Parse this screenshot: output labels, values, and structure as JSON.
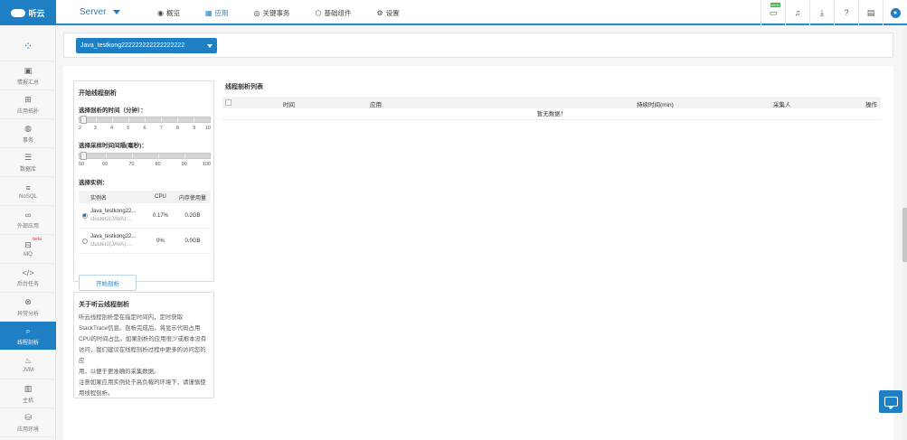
{
  "brand": {
    "logo_text": "听云",
    "accent": "#1f7fc4"
  },
  "server_selector": {
    "label": "Server"
  },
  "nav": [
    {
      "label": "概览",
      "icon": "eye-icon"
    },
    {
      "label": "应用",
      "icon": "grid-icon"
    },
    {
      "label": "关键事务",
      "icon": "target-icon"
    },
    {
      "label": "基础组件",
      "icon": "cube-icon"
    },
    {
      "label": "设置",
      "icon": "gear-icon"
    }
  ],
  "topicons": {
    "new_badge": "NEW"
  },
  "sidebar": [
    {
      "label": "情报汇总"
    },
    {
      "label": "应用拓扑"
    },
    {
      "label": "事务"
    },
    {
      "label": "数据库"
    },
    {
      "label": "NoSQL"
    },
    {
      "label": "外部应用"
    },
    {
      "label": "MQ",
      "badge": "beta"
    },
    {
      "label": "后台任务"
    },
    {
      "label": "异常分析"
    },
    {
      "label": "线程剖析"
    },
    {
      "label": "JVM"
    },
    {
      "label": "主机"
    },
    {
      "label": "应用环境"
    }
  ],
  "app_select": {
    "value": "Java_testkong222222222222222222"
  },
  "start_panel": {
    "title": "开始线程剖析",
    "duration_label": "选择剖析的时间（分钟）：",
    "duration_ticks": [
      "2",
      "3",
      "4",
      "5",
      "6",
      "7",
      "8",
      "9",
      "10"
    ],
    "duration_value": 2,
    "interval_label": "选择采样时间间隔(毫秒)：",
    "interval_ticks": [
      "50",
      "60",
      "70",
      "80",
      "90",
      "100"
    ],
    "interval_value": 50,
    "instance_label": "选择实例：",
    "columns": [
      "实例名",
      "CPU",
      "内存使用量"
    ],
    "instances": [
      {
        "name": "Java_testkong22...",
        "cluster": "cluster2(JAVA):...",
        "cpu": "0.17%",
        "mem": "0.2GB",
        "selected": true
      },
      {
        "name": "Java_testkong22...",
        "cluster": "cluster2(JAVA):...",
        "cpu": "0%",
        "mem": "0.0GB",
        "selected": false
      }
    ],
    "start_button": "开始剖析"
  },
  "about_panel": {
    "title": "关于听云线程剖析",
    "lines": [
      "听云线程剖析是在指定时间内，定时获取",
      "StackTrace信息。剖析完成后，将显示代码占用",
      "CPU的时间占比。如果剖析的应用很少或根本没有",
      "访问，我们建议在线程剖析过程中更多的访问您的应",
      "用，以便于更准确的采集数据。",
      "注意如果应用实例处于高负载的环境下，请谨慎使",
      "用线程剖析。"
    ]
  },
  "profile_list": {
    "title": "线程剖析列表",
    "columns": [
      "时间",
      "应用",
      "持续时间(min)",
      "采集人",
      "操作"
    ],
    "empty_text": "暂无数据！"
  }
}
